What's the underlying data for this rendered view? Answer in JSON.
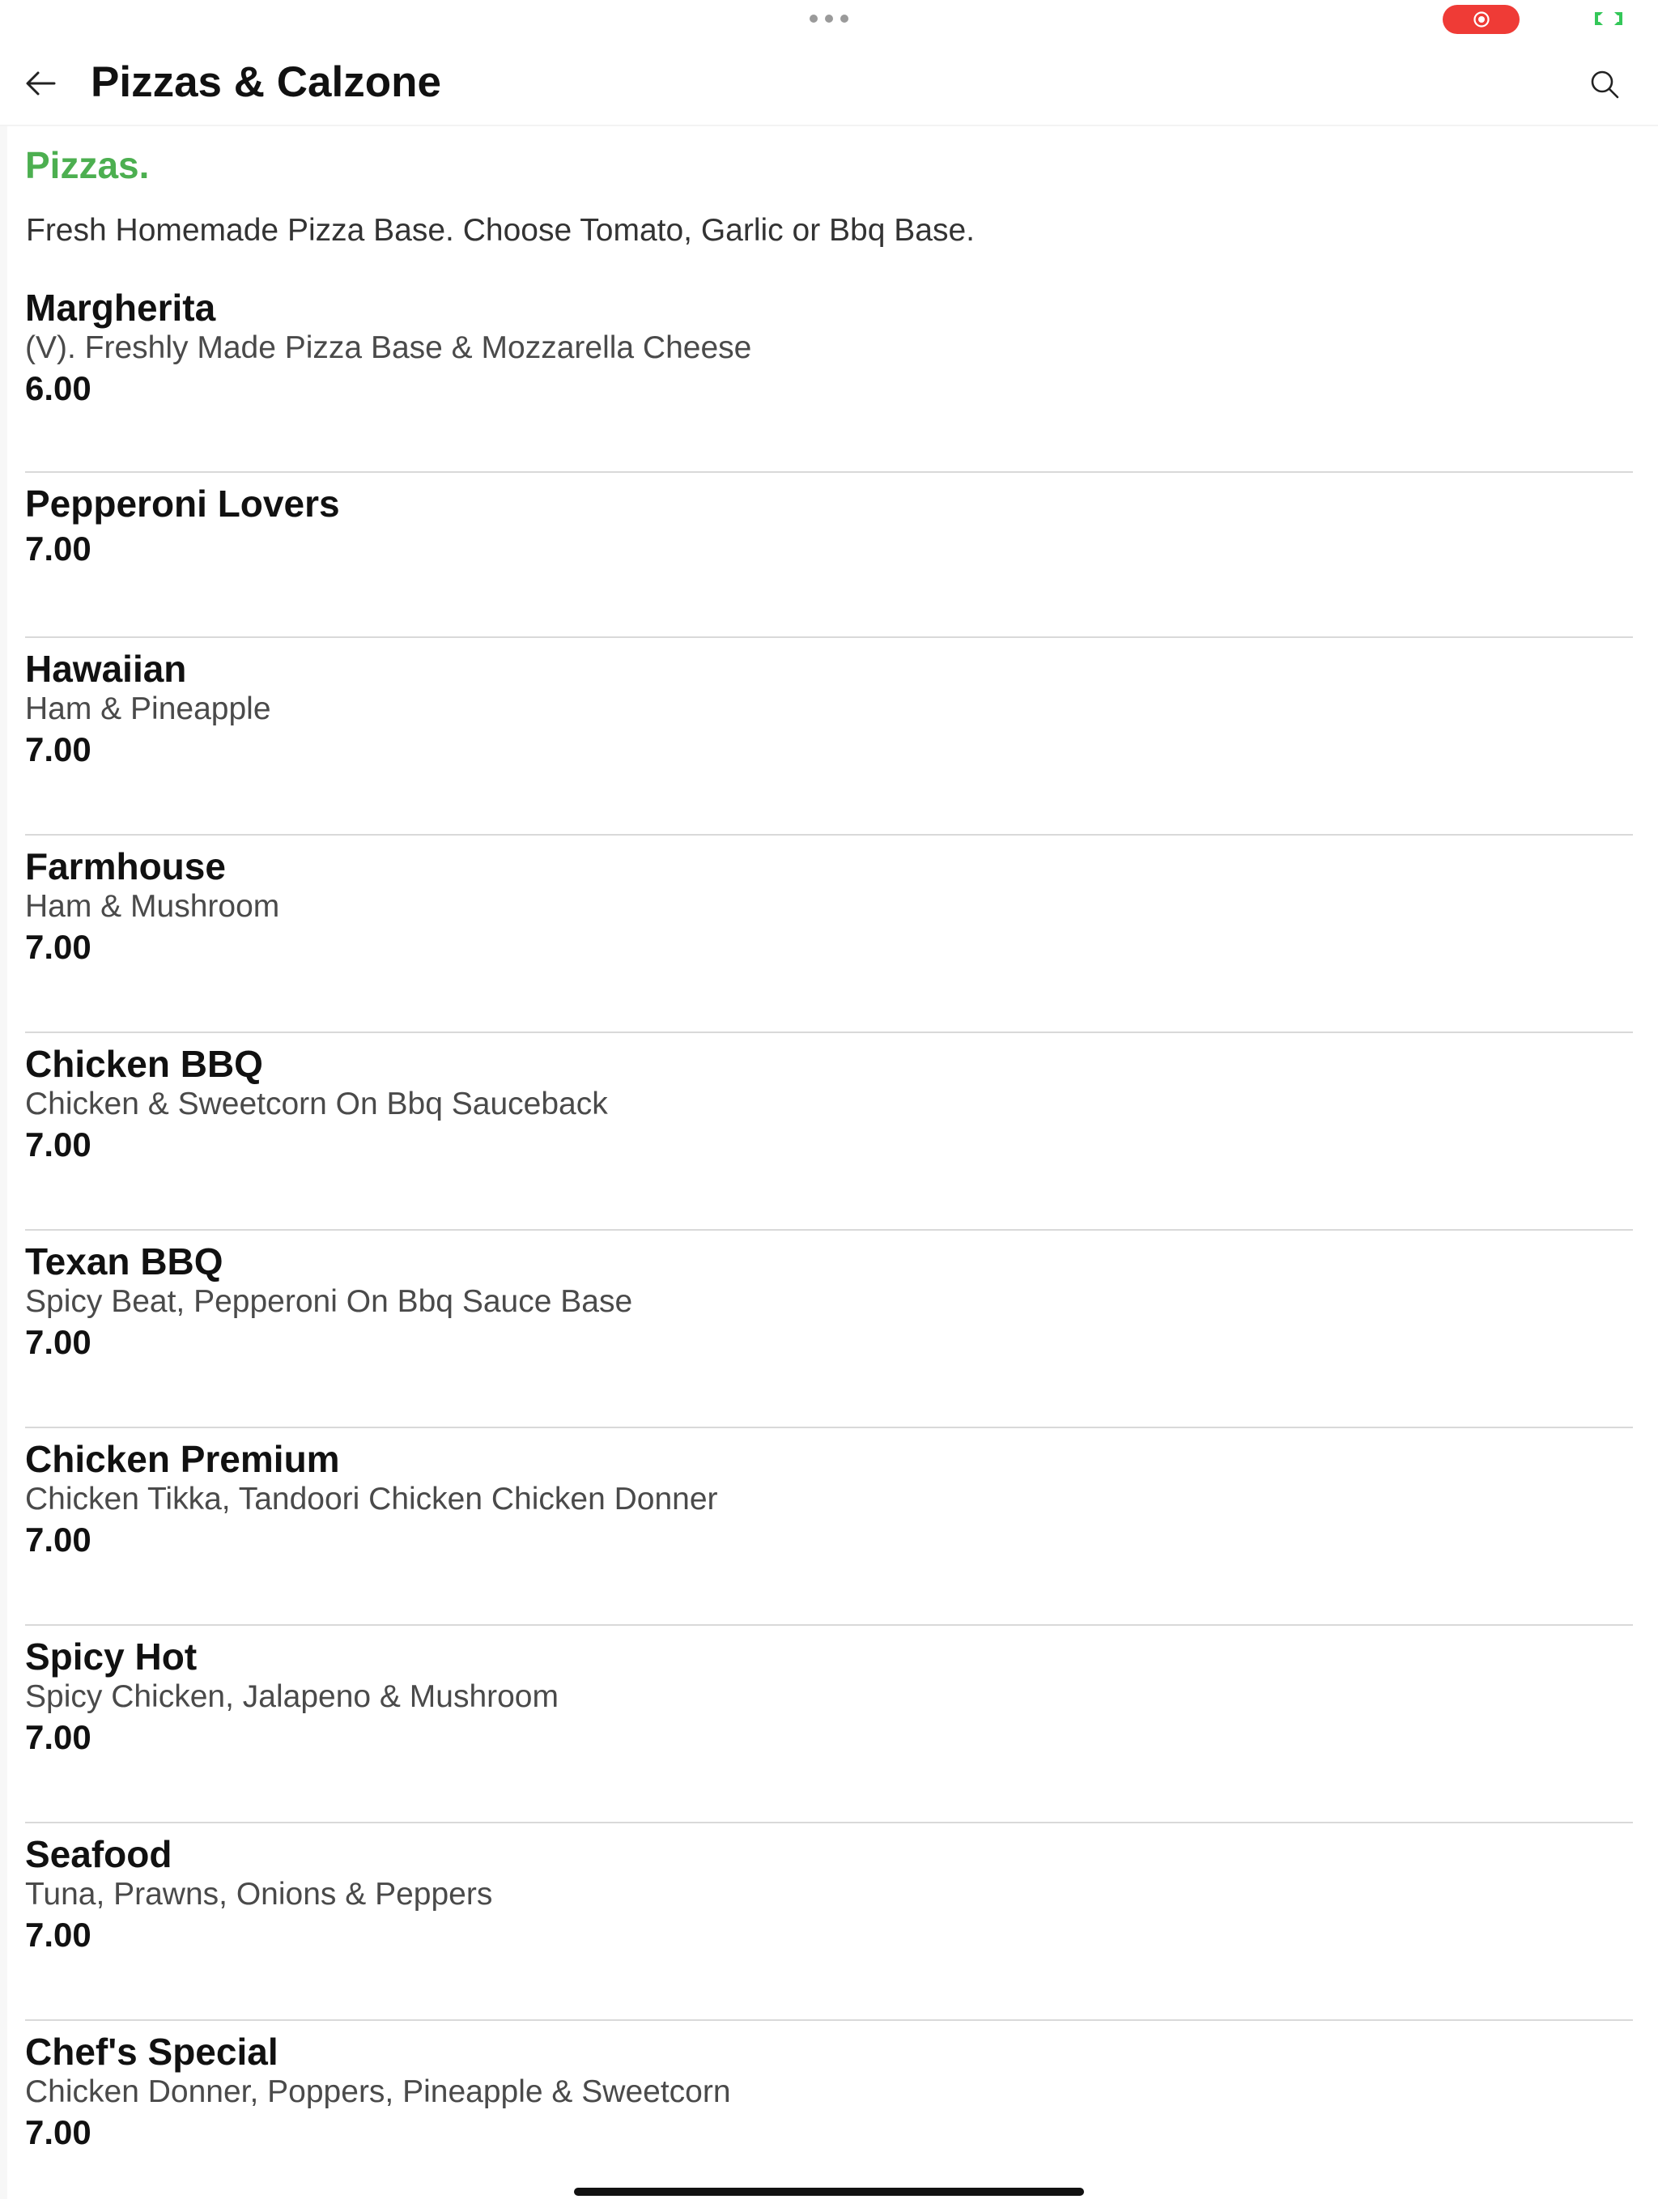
{
  "header": {
    "title": "Pizzas & Calzone",
    "back_icon": "arrow-left-icon",
    "search_icon": "search-icon"
  },
  "status_bar": {
    "multitask_icon": "more-dots-icon",
    "recording_icon": "screen-record-icon",
    "mirror_icon": "screen-mirror-icon",
    "colors": {
      "recording": "#ef3b36",
      "mirror": "#34c759"
    }
  },
  "category": {
    "title": "Pizzas.",
    "description": "Fresh Homemade Pizza Base. Choose Tomato, Garlic or Bbq Base.",
    "accent_color": "#4caf50"
  },
  "items": [
    {
      "name": "Margherita",
      "description": "(V). Freshly Made Pizza Base & Mozzarella Cheese",
      "price": "6.00"
    },
    {
      "name": "Pepperoni Lovers",
      "description": "",
      "price": "7.00"
    },
    {
      "name": "Hawaiian",
      "description": "Ham & Pineapple",
      "price": "7.00"
    },
    {
      "name": "Farmhouse",
      "description": "Ham & Mushroom",
      "price": "7.00"
    },
    {
      "name": "Chicken BBQ",
      "description": "Chicken & Sweetcorn On Bbq Sauceback",
      "price": "7.00"
    },
    {
      "name": "Texan BBQ",
      "description": "Spicy Beat, Pepperoni On Bbq Sauce Base",
      "price": "7.00"
    },
    {
      "name": "Chicken Premium",
      "description": "Chicken Tikka, Tandoori Chicken Chicken Donner",
      "price": "7.00"
    },
    {
      "name": "Spicy Hot",
      "description": "Spicy Chicken, Jalapeno & Mushroom",
      "price": "7.00"
    },
    {
      "name": "Seafood",
      "description": "Tuna, Prawns, Onions & Peppers",
      "price": "7.00"
    },
    {
      "name": "Chef's Special",
      "description": "Chicken Donner, Poppers, Pineapple & Sweetcorn",
      "price": "7.00"
    }
  ]
}
